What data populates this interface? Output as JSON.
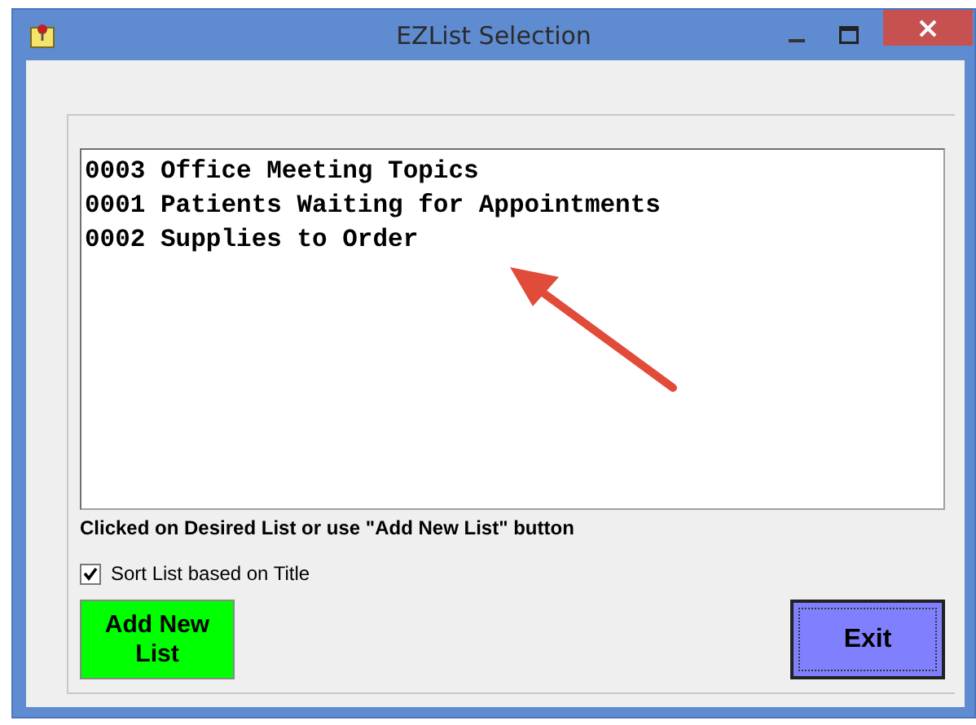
{
  "window": {
    "title": "EZList Selection"
  },
  "lists": [
    {
      "label": "0003 Office Meeting Topics",
      "selected": false
    },
    {
      "label": "0001 Patients Waiting for Appointments",
      "selected": false
    },
    {
      "label": "0002 Supplies to Order",
      "selected": false
    }
  ],
  "instruction": "Clicked on Desired List or use \"Add New List\" button",
  "sort_option": {
    "label": "Sort List based on Title",
    "checked": true
  },
  "buttons": [
    {
      "label": "Add New List",
      "kind": "add"
    },
    {
      "label": "Exit",
      "kind": "exit"
    }
  ]
}
